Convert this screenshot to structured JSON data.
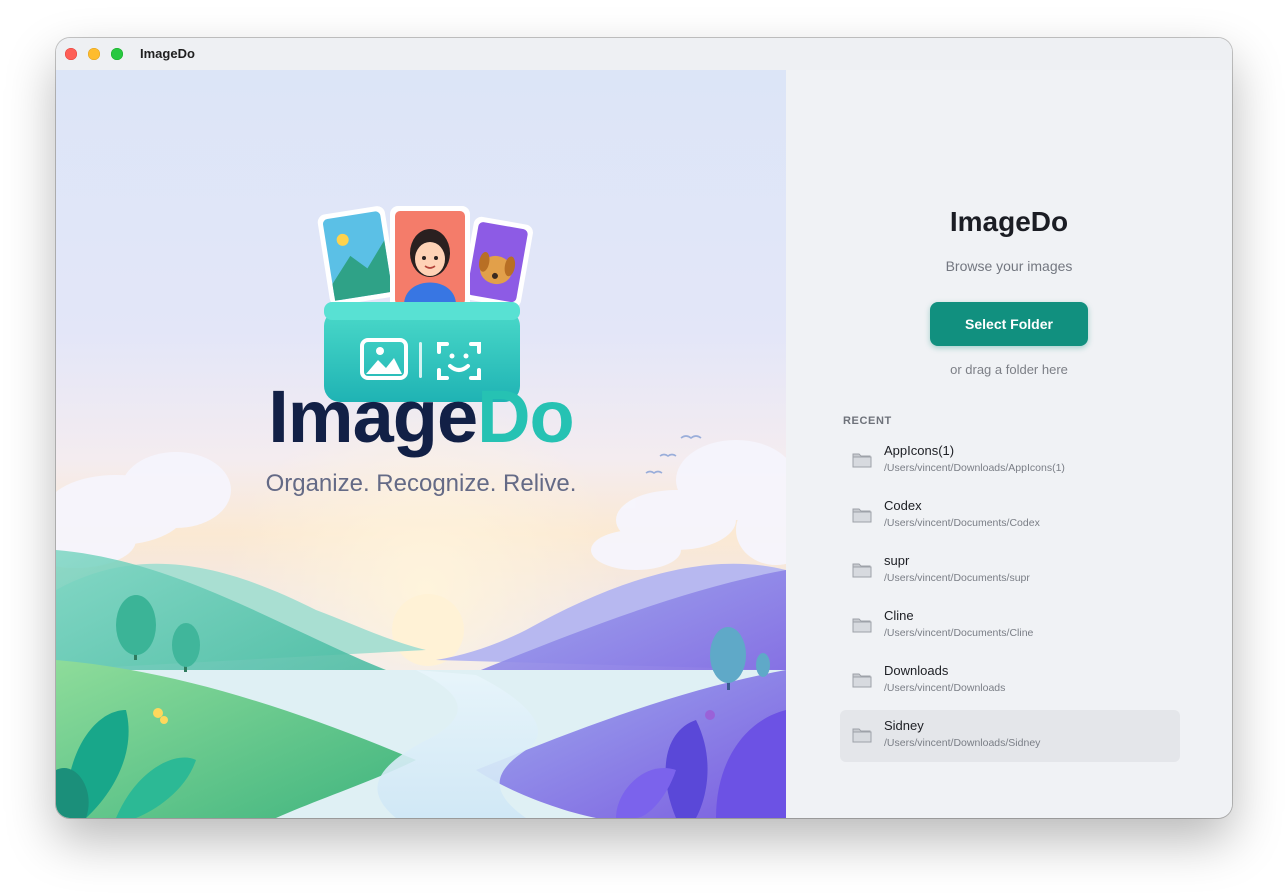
{
  "window": {
    "title": "ImageDo"
  },
  "hero": {
    "logo_part1": "Image",
    "logo_part2": "Do",
    "tagline": "Organize. Recognize. Relive."
  },
  "panel": {
    "title": "ImageDo",
    "subtitle": "Browse your images",
    "select_button": "Select Folder",
    "drag_hint": "or drag a folder here",
    "recent_label": "RECENT",
    "recent": [
      {
        "name": "AppIcons(1)",
        "path": "/Users/vincent/Downloads/AppIcons(1)"
      },
      {
        "name": "Codex",
        "path": "/Users/vincent/Documents/Codex"
      },
      {
        "name": "supr",
        "path": "/Users/vincent/Documents/supr"
      },
      {
        "name": "Cline",
        "path": "/Users/vincent/Documents/Cline"
      },
      {
        "name": "Downloads",
        "path": "/Users/vincent/Downloads"
      },
      {
        "name": "Sidney",
        "path": "/Users/vincent/Downloads/Sidney"
      }
    ]
  },
  "colors": {
    "accent": "#11907f",
    "logo_dark": "#122046",
    "logo_teal": "#26c2b3"
  },
  "icons": [
    "folder-icon",
    "close-icon",
    "minimize-icon",
    "zoom-icon"
  ]
}
